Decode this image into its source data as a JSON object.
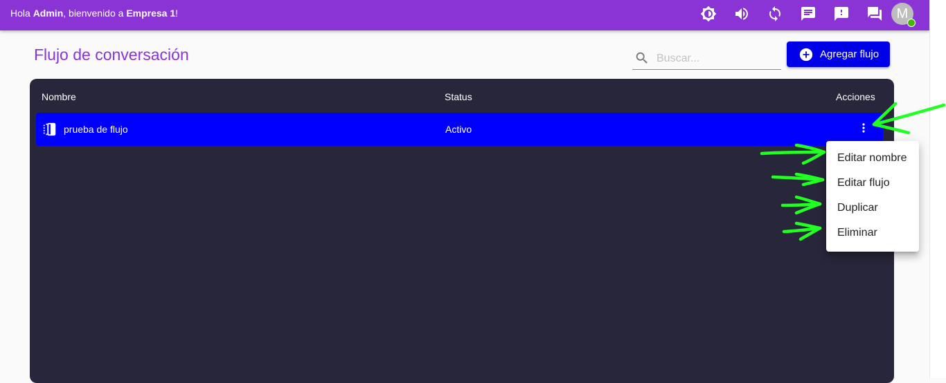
{
  "header": {
    "greeting_prefix": "Hola ",
    "user_name": "Admin",
    "greeting_middle": ", bienvenido a ",
    "company_name": "Empresa 1",
    "greeting_suffix": "!",
    "avatar_initial": "M",
    "bar_color": "#8a34d6",
    "toolbar_icons": [
      "brightness-icon",
      "volume-icon",
      "sync-icon",
      "chat-icon",
      "feedback-icon",
      "forum-icon"
    ]
  },
  "page": {
    "title": "Flujo de conversación"
  },
  "search": {
    "placeholder": "Buscar..."
  },
  "add_button": {
    "label": "Agregar flujo",
    "color": "#0000e8"
  },
  "table": {
    "columns": [
      "Nombre",
      "Status",
      "Acciones"
    ],
    "rows": [
      {
        "name": "prueba de flujo",
        "status": "Activo",
        "highlight_color": "#0000ff"
      }
    ]
  },
  "actions_menu": {
    "items": [
      "Editar nombre",
      "Editar flujo",
      "Duplicar",
      "Eliminar"
    ]
  },
  "annotation_color": "#22ff22"
}
